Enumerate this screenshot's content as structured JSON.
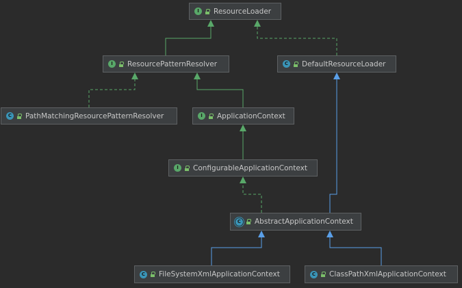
{
  "diagram": {
    "nodes": [
      {
        "id": "resource-loader",
        "label": "ResourceLoader",
        "kind": "interface",
        "kind_letter": "I"
      },
      {
        "id": "resource-pattern-resolver",
        "label": "ResourcePatternResolver",
        "kind": "interface",
        "kind_letter": "I"
      },
      {
        "id": "default-resource-loader",
        "label": "DefaultResourceLoader",
        "kind": "class",
        "kind_letter": "C"
      },
      {
        "id": "path-matching-resource-pattern-resolver",
        "label": "PathMatchingResourcePatternResolver",
        "kind": "class",
        "kind_letter": "C"
      },
      {
        "id": "application-context",
        "label": "ApplicationContext",
        "kind": "interface",
        "kind_letter": "I"
      },
      {
        "id": "configurable-application-context",
        "label": "ConfigurableApplicationContext",
        "kind": "interface",
        "kind_letter": "I"
      },
      {
        "id": "abstract-application-context",
        "label": "AbstractApplicationContext",
        "kind": "abstract",
        "kind_letter": "C"
      },
      {
        "id": "file-system-xml-application-context",
        "label": "FileSystemXmlApplicationContext",
        "kind": "class",
        "kind_letter": "C"
      },
      {
        "id": "class-path-xml-application-context",
        "label": "ClassPathXmlApplicationContext",
        "kind": "class",
        "kind_letter": "C"
      }
    ],
    "edges": [
      {
        "from": "resource-pattern-resolver",
        "to": "resource-loader",
        "relation": "extends-interface"
      },
      {
        "from": "default-resource-loader",
        "to": "resource-loader",
        "relation": "implements"
      },
      {
        "from": "path-matching-resource-pattern-resolver",
        "to": "resource-pattern-resolver",
        "relation": "implements"
      },
      {
        "from": "application-context",
        "to": "resource-pattern-resolver",
        "relation": "extends-interface"
      },
      {
        "from": "configurable-application-context",
        "to": "application-context",
        "relation": "extends-interface"
      },
      {
        "from": "abstract-application-context",
        "to": "configurable-application-context",
        "relation": "implements"
      },
      {
        "from": "abstract-application-context",
        "to": "default-resource-loader",
        "relation": "extends-class"
      },
      {
        "from": "file-system-xml-application-context",
        "to": "abstract-application-context",
        "relation": "extends-class"
      },
      {
        "from": "class-path-xml-application-context",
        "to": "abstract-application-context",
        "relation": "extends-class"
      }
    ],
    "colors": {
      "background": "#2b2b2b",
      "node_fill": "#3c3f41",
      "interface_edge": "#59a869",
      "class_edge": "#5a9fe8",
      "interface_badge": "#59a869",
      "class_badge": "#3a95b8"
    }
  }
}
